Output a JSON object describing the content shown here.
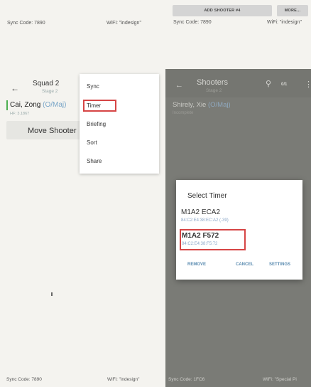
{
  "top_left_status": {
    "sync": "Sync Code: 7890",
    "wifi": "WiFi: \"indesign\""
  },
  "top_right_status": {
    "add_shooter": "ADD SHOOTER #4",
    "more": "MORE...",
    "sync": "Sync Code: 7890",
    "wifi": "WiFi: \"indesign\""
  },
  "left_phone": {
    "back_icon": "back-arrow-icon",
    "title": "Squad 2",
    "subtitle": "Stage 2",
    "shooter": {
      "name": "Cai, Zong",
      "division": "(O/Maj)",
      "hf": "HF: 3.1867"
    },
    "move_button": "Move Shooter",
    "menu": [
      "Sync",
      "Timer",
      "Briefing",
      "Sort",
      "Share"
    ],
    "menu_highlighted": "Timer",
    "footer": {
      "sync": "Sync Code: 7890",
      "wifi": "WiFi: \"indesign\""
    }
  },
  "right_phone": {
    "back_icon": "back-arrow-icon",
    "title": "Shooters",
    "subtitle": "Stage 2",
    "search_icon": "search-icon",
    "count": "0/1",
    "more_icon": "more-vert-icon",
    "shooter": {
      "name": "Shirely, Xie",
      "division": "(O/Maj)",
      "status": "Incomplete"
    },
    "dialog": {
      "title": "Select Timer",
      "timers": [
        {
          "name": "M1A2 ECA2",
          "mac": "84:C2:E4:38:EC:A2 (-39)",
          "selected": false
        },
        {
          "name": "M1A2 F572",
          "mac": "84:C2:E4:38:F5:72",
          "selected": true
        }
      ],
      "actions": {
        "remove": "REMOVE",
        "cancel": "CANCEL",
        "settings": "SETTINGS"
      }
    },
    "footer": {
      "sync": "Sync Code: 1FC6",
      "wifi": "WiFi: \"Special Pi"
    }
  }
}
